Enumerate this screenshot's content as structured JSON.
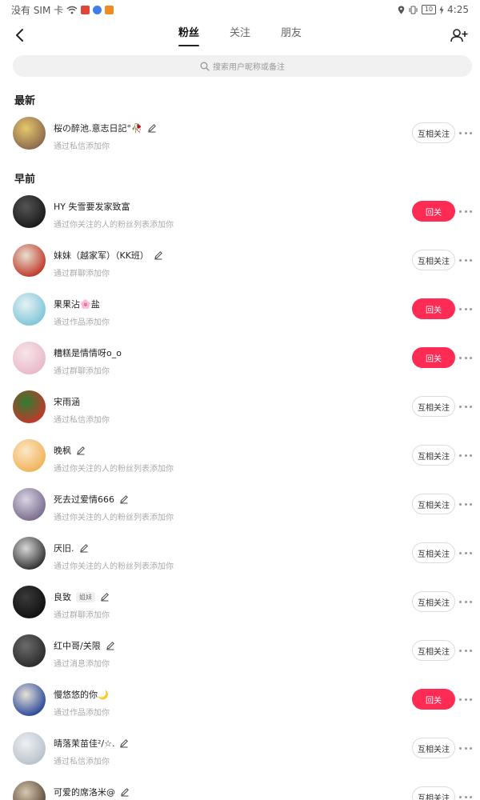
{
  "status_bar": {
    "carrier": "没有 SIM 卡",
    "battery": "10",
    "time": "4:25"
  },
  "header": {
    "tabs": [
      {
        "label": "粉丝",
        "active": true
      },
      {
        "label": "关注",
        "active": false
      },
      {
        "label": "朋友",
        "active": false
      }
    ]
  },
  "search": {
    "placeholder": "搜索用户昵称或备注"
  },
  "sections": {
    "latest": "最新",
    "earlier": "早前"
  },
  "colors": {
    "accent": "#fe2c55",
    "outline": "#dcdcdc"
  },
  "latest_rows": [
    {
      "name": "桜の醉池.意志日記°🥀",
      "editable": true,
      "badge": "",
      "subtitle": "通过私信添加你",
      "action": "互相关注",
      "action_style": "outline",
      "avatar_colors": [
        "#8b6a4f",
        "#e7c86a"
      ]
    }
  ],
  "earlier_rows": [
    {
      "name": "HY   失雪要发家致富",
      "editable": false,
      "badge": "",
      "subtitle": "通过你关注的人的粉丝列表添加你",
      "action": "回关",
      "action_style": "red",
      "avatar_colors": [
        "#1a1a1a",
        "#555555"
      ]
    },
    {
      "name": "妹妹（越家军）（KK班）",
      "editable": true,
      "badge": "",
      "subtitle": "通过群聊添加你",
      "action": "互相关注",
      "action_style": "outline",
      "avatar_colors": [
        "#c0392b",
        "#e8e0d0"
      ]
    },
    {
      "name": "果果沾🌸盐",
      "editable": false,
      "badge": "",
      "subtitle": "通过作品添加你",
      "action": "回关",
      "action_style": "red",
      "avatar_colors": [
        "#7fc6d8",
        "#e6f2f5"
      ]
    },
    {
      "name": "糟糕是情情呀o_o",
      "editable": false,
      "badge": "",
      "subtitle": "通过群聊添加你",
      "action": "回关",
      "action_style": "red",
      "avatar_colors": [
        "#e9b9c9",
        "#f7e6ea"
      ]
    },
    {
      "name": "宋雨涵",
      "editable": false,
      "badge": "",
      "subtitle": "通过私信添加你",
      "action": "互相关注",
      "action_style": "outline",
      "avatar_colors": [
        "#c0392b",
        "#2e7d32"
      ]
    },
    {
      "name": "晚枫",
      "editable": true,
      "badge": "",
      "subtitle": "通过你关注的人的粉丝列表添加你",
      "action": "互相关注",
      "action_style": "outline",
      "avatar_colors": [
        "#f0b35a",
        "#fbe7c6"
      ]
    },
    {
      "name": "死去过爱情666",
      "editable": true,
      "badge": "",
      "subtitle": "通过你关注的人的粉丝列表添加你",
      "action": "互相关注",
      "action_style": "outline",
      "avatar_colors": [
        "#7b6d8d",
        "#d9d4e3"
      ]
    },
    {
      "name": "厌旧.",
      "editable": true,
      "badge": "",
      "subtitle": "通过你关注的人的粉丝列表添加你",
      "action": "互相关注",
      "action_style": "outline",
      "avatar_colors": [
        "#333333",
        "#d8d8d8"
      ]
    },
    {
      "name": "良致",
      "editable": true,
      "badge": "姐妹",
      "subtitle": "通过群聊添加你",
      "action": "互相关注",
      "action_style": "outline",
      "avatar_colors": [
        "#111111",
        "#3a3a3a"
      ]
    },
    {
      "name": "红中哥/关限",
      "editable": true,
      "badge": "",
      "subtitle": "通过消息添加你",
      "action": "互相关注",
      "action_style": "outline",
      "avatar_colors": [
        "#2b2b2b",
        "#6b6b6b"
      ]
    },
    {
      "name": "慢悠悠的你🌙",
      "editable": false,
      "badge": "",
      "subtitle": "通过作品添加你",
      "action": "回关",
      "action_style": "red",
      "avatar_colors": [
        "#2c4a9a",
        "#e6e2d8"
      ]
    },
    {
      "name": "晴落茉苗佳²/☆.",
      "editable": true,
      "badge": "",
      "subtitle": "通过私信添加你",
      "action": "互相关注",
      "action_style": "outline",
      "avatar_colors": [
        "#b9c2cc",
        "#eef0f3"
      ]
    },
    {
      "name": "可爱的席洛米@",
      "editable": true,
      "badge": "",
      "subtitle": "",
      "action": "互相关注",
      "action_style": "outline",
      "avatar_colors": [
        "#5a4a3a",
        "#d8c8b0"
      ]
    }
  ]
}
